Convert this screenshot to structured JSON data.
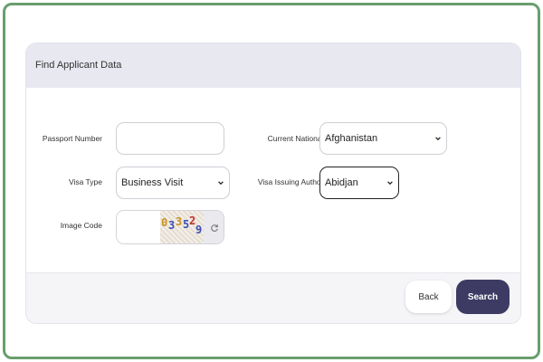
{
  "form": {
    "title": "Find Applicant Data",
    "passport_number": {
      "label": "Passport Number",
      "value": ""
    },
    "visa_type": {
      "label": "Visa Type",
      "value": "Business Visit"
    },
    "image_code": {
      "label": "Image Code",
      "value": "",
      "captcha_text": "03352 9"
    },
    "current_nationality": {
      "label": "Current Nationality",
      "value": "Afghanistan"
    },
    "visa_issuing_authority": {
      "label": "Visa Issuing Authority",
      "value": "Abidjan"
    }
  },
  "buttons": {
    "back": "Back",
    "search": "Search"
  },
  "colors": {
    "frame_border": "#6a9e6e",
    "header_bg": "#e8e8f1",
    "primary": "#3d3b63"
  },
  "icons": {
    "refresh": "refresh-icon",
    "chevron": "chevron-down-icon"
  }
}
